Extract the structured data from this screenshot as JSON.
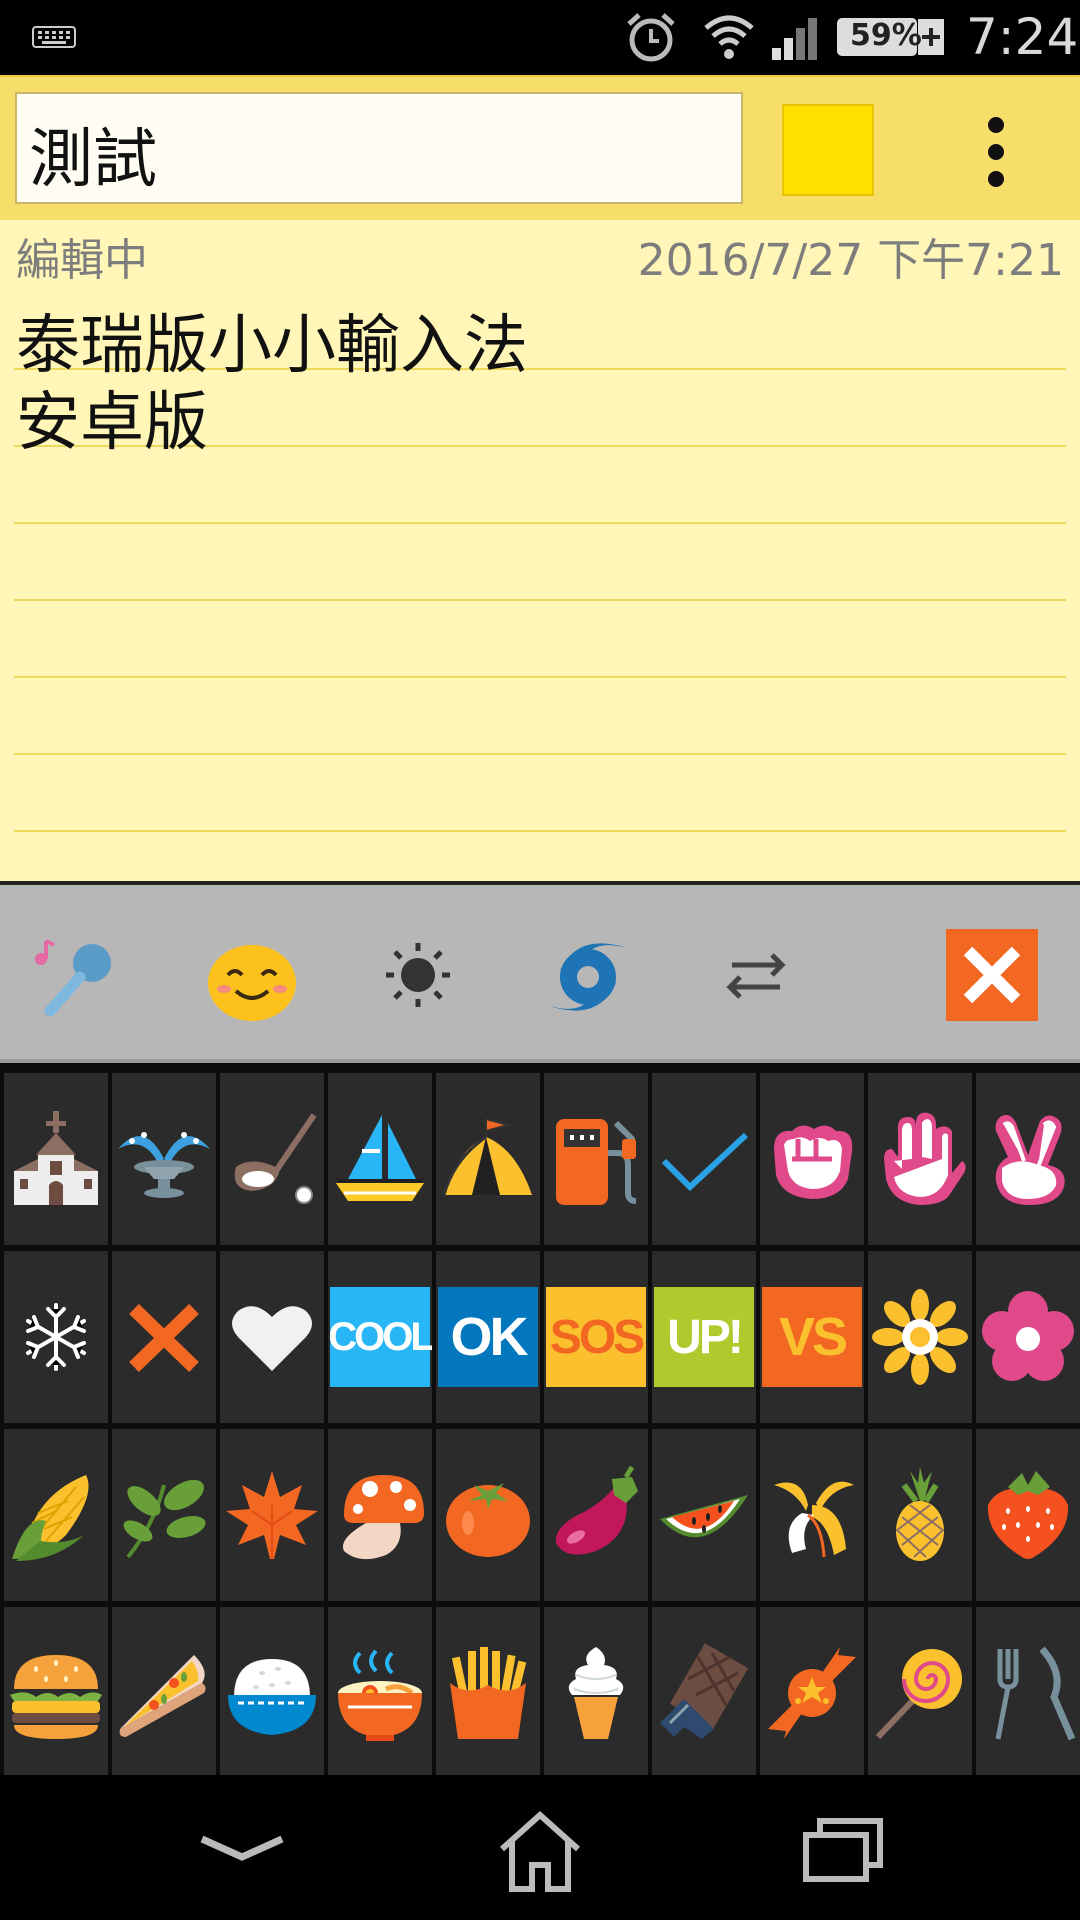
{
  "status_bar": {
    "icons": [
      "keyboard-icon",
      "alarm-icon",
      "wifi-icon",
      "signal-icon",
      "battery-icon"
    ],
    "battery": "59%",
    "time": "7:24"
  },
  "note": {
    "title": "測試",
    "color": "#ffe000",
    "status": "編輯中",
    "timestamp": "2016/7/27 下午7:21",
    "content": "泰瑞版小小輸入法\n安卓版"
  },
  "emoji_toolbar": {
    "buttons": [
      "microphone-icon",
      "smiley-icon",
      "sun-icon",
      "cyclone-icon",
      "swap-arrows-icon",
      "close-icon"
    ]
  },
  "emoji_grid": {
    "rows": [
      [
        "church",
        "fountain",
        "golf",
        "sailboat",
        "tent",
        "fuel-pump",
        "check-mark",
        "fist",
        "raised-hand",
        "victory-hand"
      ],
      [
        "snowflake",
        "cross-mark",
        "heart",
        "COOL",
        "OK",
        "SOS",
        "UP!",
        "VS",
        "sunflower",
        "blossom"
      ],
      [
        "corn",
        "herb",
        "maple-leaf",
        "mushroom",
        "tomato",
        "eggplant",
        "watermelon",
        "banana",
        "pineapple",
        "strawberry"
      ],
      [
        "hamburger",
        "pizza",
        "rice",
        "ramen",
        "fries",
        "soft-serve",
        "chocolate-bar",
        "candy",
        "lollipop",
        "fork-and-knife"
      ]
    ],
    "labels": {
      "cool": "COOL",
      "ok": "OK",
      "sos": "SOS",
      "up": "UP!",
      "vs": "VS"
    }
  },
  "nav_bar": {
    "buttons": [
      "back-chevron-icon",
      "home-icon",
      "recent-apps-icon"
    ]
  }
}
